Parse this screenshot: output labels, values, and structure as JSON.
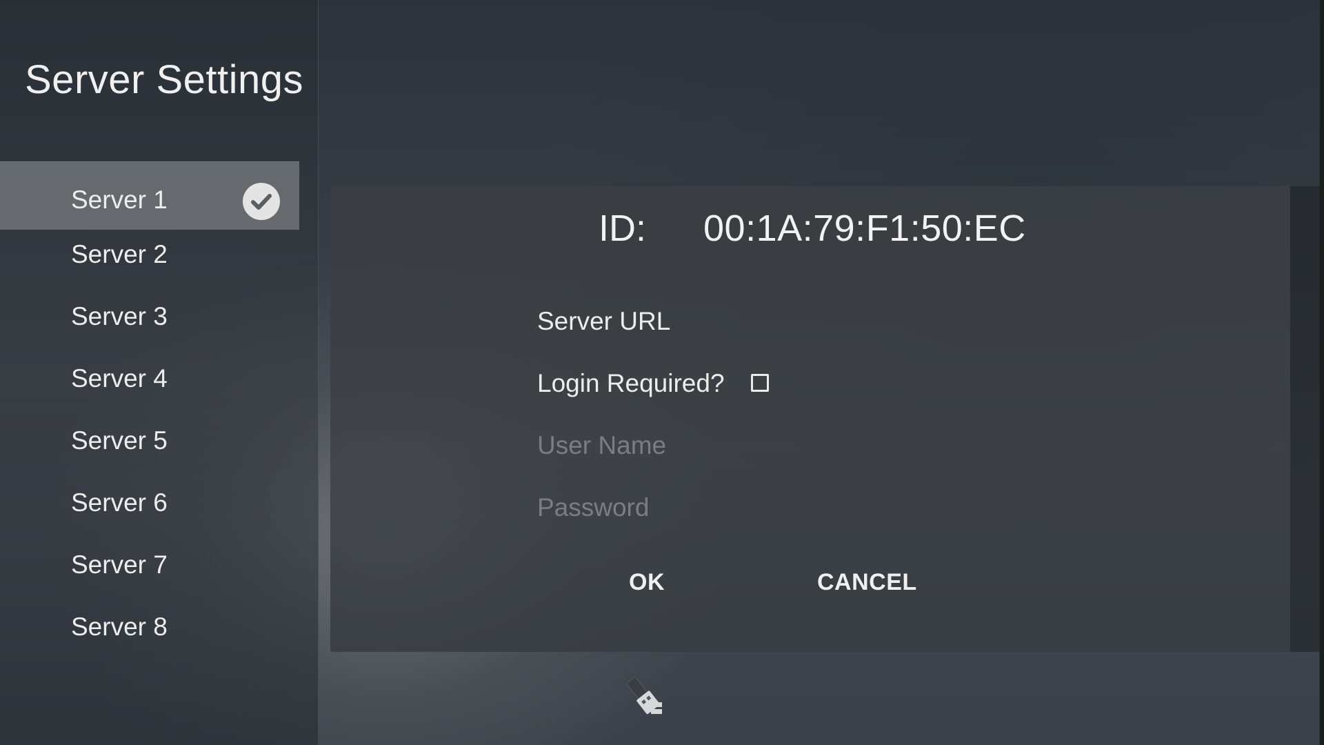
{
  "sidebar": {
    "title": "Server Settings",
    "items": [
      {
        "label": "Server 1",
        "selected": true
      },
      {
        "label": "Server 2"
      },
      {
        "label": "Server 3"
      },
      {
        "label": "Server 4"
      },
      {
        "label": "Server 5"
      },
      {
        "label": "Server 6"
      },
      {
        "label": "Server 7"
      },
      {
        "label": "Server 8"
      }
    ]
  },
  "dialog": {
    "id_label": "ID:",
    "id_value": "00:1A:79:F1:50:EC",
    "server_url_label": "Server URL",
    "login_required_label": "Login Required?",
    "login_required_checked": false,
    "username_placeholder": "User Name",
    "password_placeholder": "Password",
    "ok_label": "OK",
    "cancel_label": "CANCEL"
  },
  "icons": {
    "selected_check": "check-circle-icon",
    "bottom": "usb-drive-icon"
  },
  "colors": {
    "selected_bg": "#7c8084",
    "placeholder": "#7a7e82",
    "text": "#ececec"
  }
}
